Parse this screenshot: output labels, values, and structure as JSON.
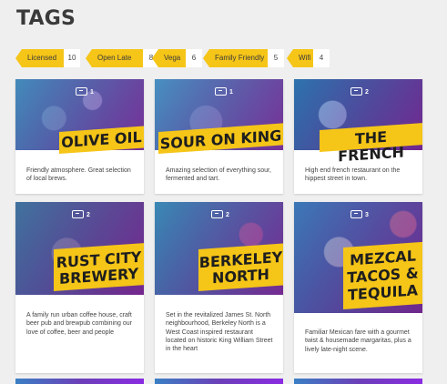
{
  "page": {
    "title": "TAGS"
  },
  "tags": [
    {
      "label": "Licensed",
      "count": "10"
    },
    {
      "label": "Open Late",
      "count": "8"
    },
    {
      "label": "Vega",
      "count": "6"
    },
    {
      "label": "Family Friendly",
      "count": "5"
    },
    {
      "label": "Wifi",
      "count": "4"
    }
  ],
  "cards": [
    {
      "name": "OLIVE OIL",
      "photos": "1",
      "description": "Friendly atmosphere. Great selection of local brews."
    },
    {
      "name": "SOUR ON KING",
      "photos": "1",
      "description": "Amazing selection of everything sour, fermented and tart."
    },
    {
      "name": "THE FRENCH",
      "photos": "2",
      "description": "High end french restaurant on the hippest street in town."
    },
    {
      "name": "RUST CITY BREWERY",
      "photos": "2",
      "description": "A family run urban coffee house, craft beer pub and brewpub combining our love of coffee, beer and people"
    },
    {
      "name": "BERKELEY NORTH",
      "photos": "2",
      "description": "Set in the revitalized James St. North neighbourhood, Berkeley North is a West Coast inspired restaurant located on historic King William Street in the heart"
    },
    {
      "name": "MEZCAL TACOS & TEQUILA",
      "photos": "3",
      "description": "Familiar Mexican fare with a gourmet twist & housemade margaritas, plus a lively late-night scene."
    }
  ],
  "colors": {
    "accent": "#f5c518",
    "background": "#efefef",
    "overlay_start": "#1e88e5",
    "overlay_end": "#8e24aa"
  }
}
